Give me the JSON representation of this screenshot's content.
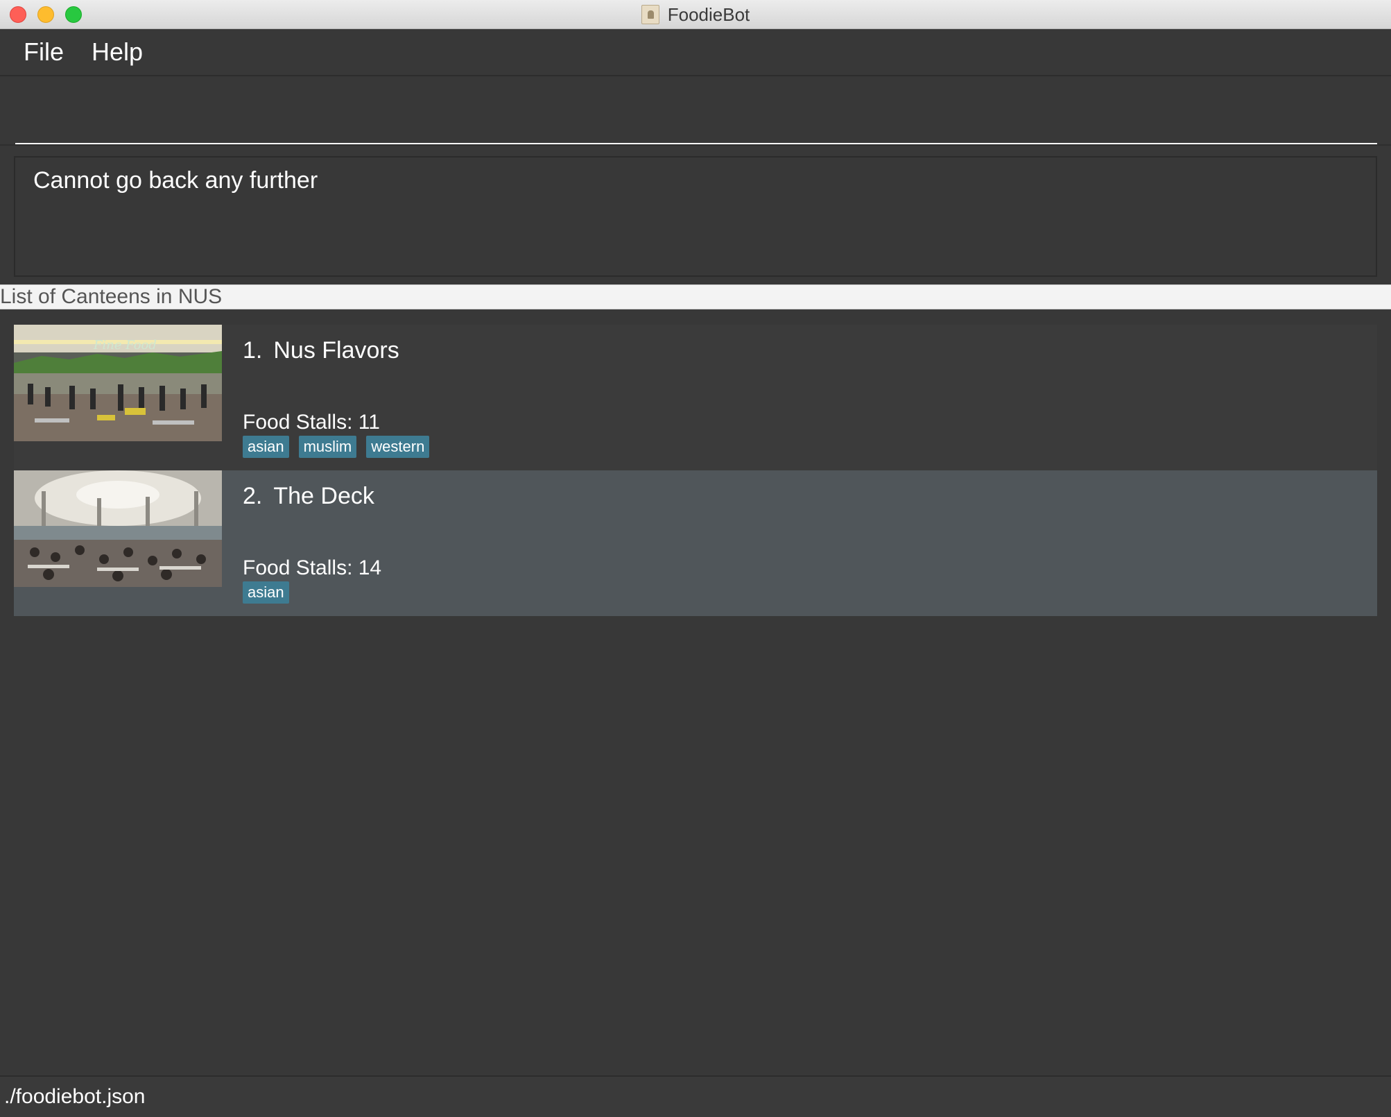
{
  "window": {
    "title": "FoodieBot",
    "buttons": [
      "close",
      "minimize",
      "maximize"
    ]
  },
  "menubar": {
    "items": [
      "File",
      "Help"
    ]
  },
  "command_box": {
    "value": "",
    "placeholder": ""
  },
  "result_display": {
    "text": "Cannot go back any further"
  },
  "list_panel": {
    "header": "List of Canteens in NUS",
    "items": [
      {
        "index": "1.",
        "name": "Nus Flavors",
        "stalls": "Food Stalls: 11",
        "tags": [
          "asian",
          "muslim",
          "western"
        ],
        "image": "canteen-fine-food-photo"
      },
      {
        "index": "2.",
        "name": "The Deck",
        "stalls": "Food Stalls: 14",
        "tags": [
          "asian"
        ],
        "image": "canteen-the-deck-photo"
      }
    ]
  },
  "statusbar": {
    "path": "./foodiebot.json"
  },
  "colors": {
    "background": "#383838",
    "selected_card": "#50565a",
    "tag": "#3e7b91"
  }
}
